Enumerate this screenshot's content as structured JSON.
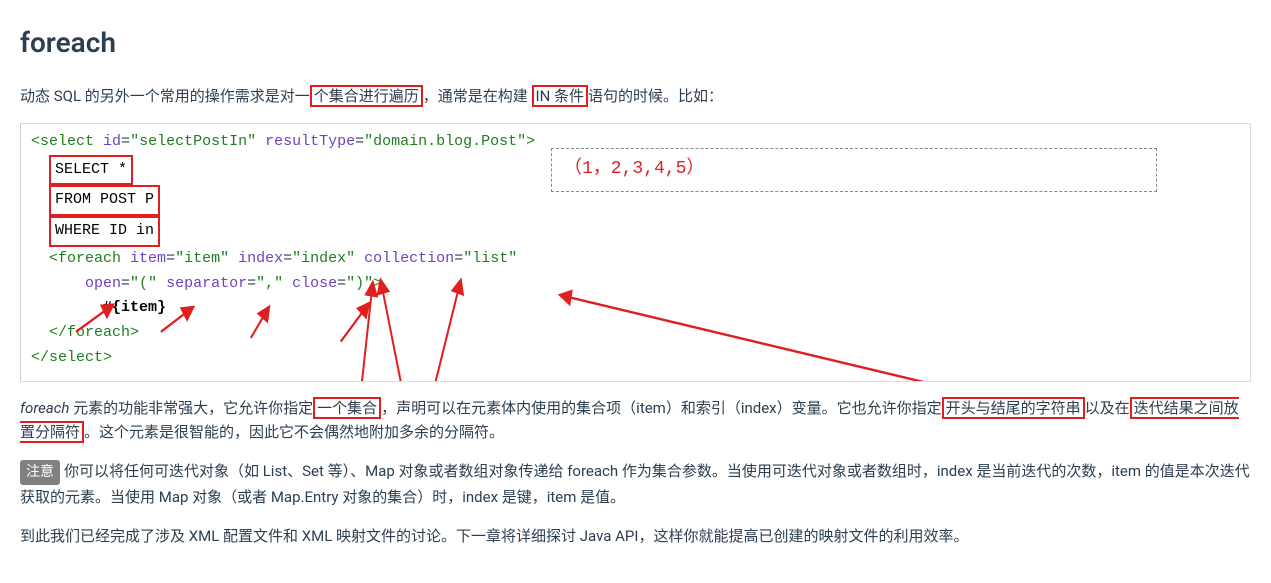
{
  "heading": "foreach",
  "intro": {
    "seg1": "动态 SQL 的另外一个常用的操作需求是对一",
    "hl1": "个集合进行遍历",
    "seg2": "，通常是在构建 ",
    "hl2": "IN 条件",
    "seg3": "语句的时候。比如："
  },
  "code": {
    "line1": {
      "open": "<select",
      "attr_id": "id",
      "val_id": "\"selectPostIn\"",
      "attr_rt": "resultType",
      "val_rt": "\"domain.blog.Post\"",
      "close": ">"
    },
    "sql_select": "SELECT *",
    "sql_from": "FROM POST P",
    "sql_where": "WHERE ID in",
    "foreach_open": {
      "tag": "<foreach",
      "a_item": "item",
      "v_item": "\"item\"",
      "a_index": "index",
      "v_index": "\"index\"",
      "a_coll": "collection",
      "v_coll": "\"list\""
    },
    "foreach_open2": {
      "a_open": "open",
      "v_open": "\"(\"",
      "a_sep": "separator",
      "v_sep": "\",\"",
      "a_close": "close",
      "v_close": "\")\"",
      "end": ">"
    },
    "foreach_body": "#{item}",
    "foreach_close": "</foreach>",
    "select_close": "</select>",
    "overlay": "（1，2,3,4,5）"
  },
  "para2": {
    "seg1_pre": "foreach",
    "seg1": " 元素的功能非常强大，它允许你指定",
    "hl1": "一个集合",
    "seg2": "，声明可以在元素体内使用的集合项（item）和索引（index）变量。它也允许你指定",
    "hl2": "开头与结尾的字符串",
    "seg3": "以及在",
    "hl3": "迭代结果之间放置分隔符",
    "seg4": "。这个元素是很智能的，因此它不会偶然地附加多余的分隔符。"
  },
  "note_label": "注意",
  "para3": "你可以将任何可迭代对象（如 List、Set 等）、Map 对象或者数组对象传递给 foreach 作为集合参数。当使用可迭代对象或者数组时，index 是当前迭代的次数，item 的值是本次迭代获取的元素。当使用 Map 对象（或者 Map.Entry 对象的集合）时，index 是键，item 是值。",
  "para4": "到此我们已经完成了涉及 XML 配置文件和 XML 映射文件的讨论。下一章将详细探讨 Java API，这样你就能提高已创建的映射文件的利用效率。"
}
